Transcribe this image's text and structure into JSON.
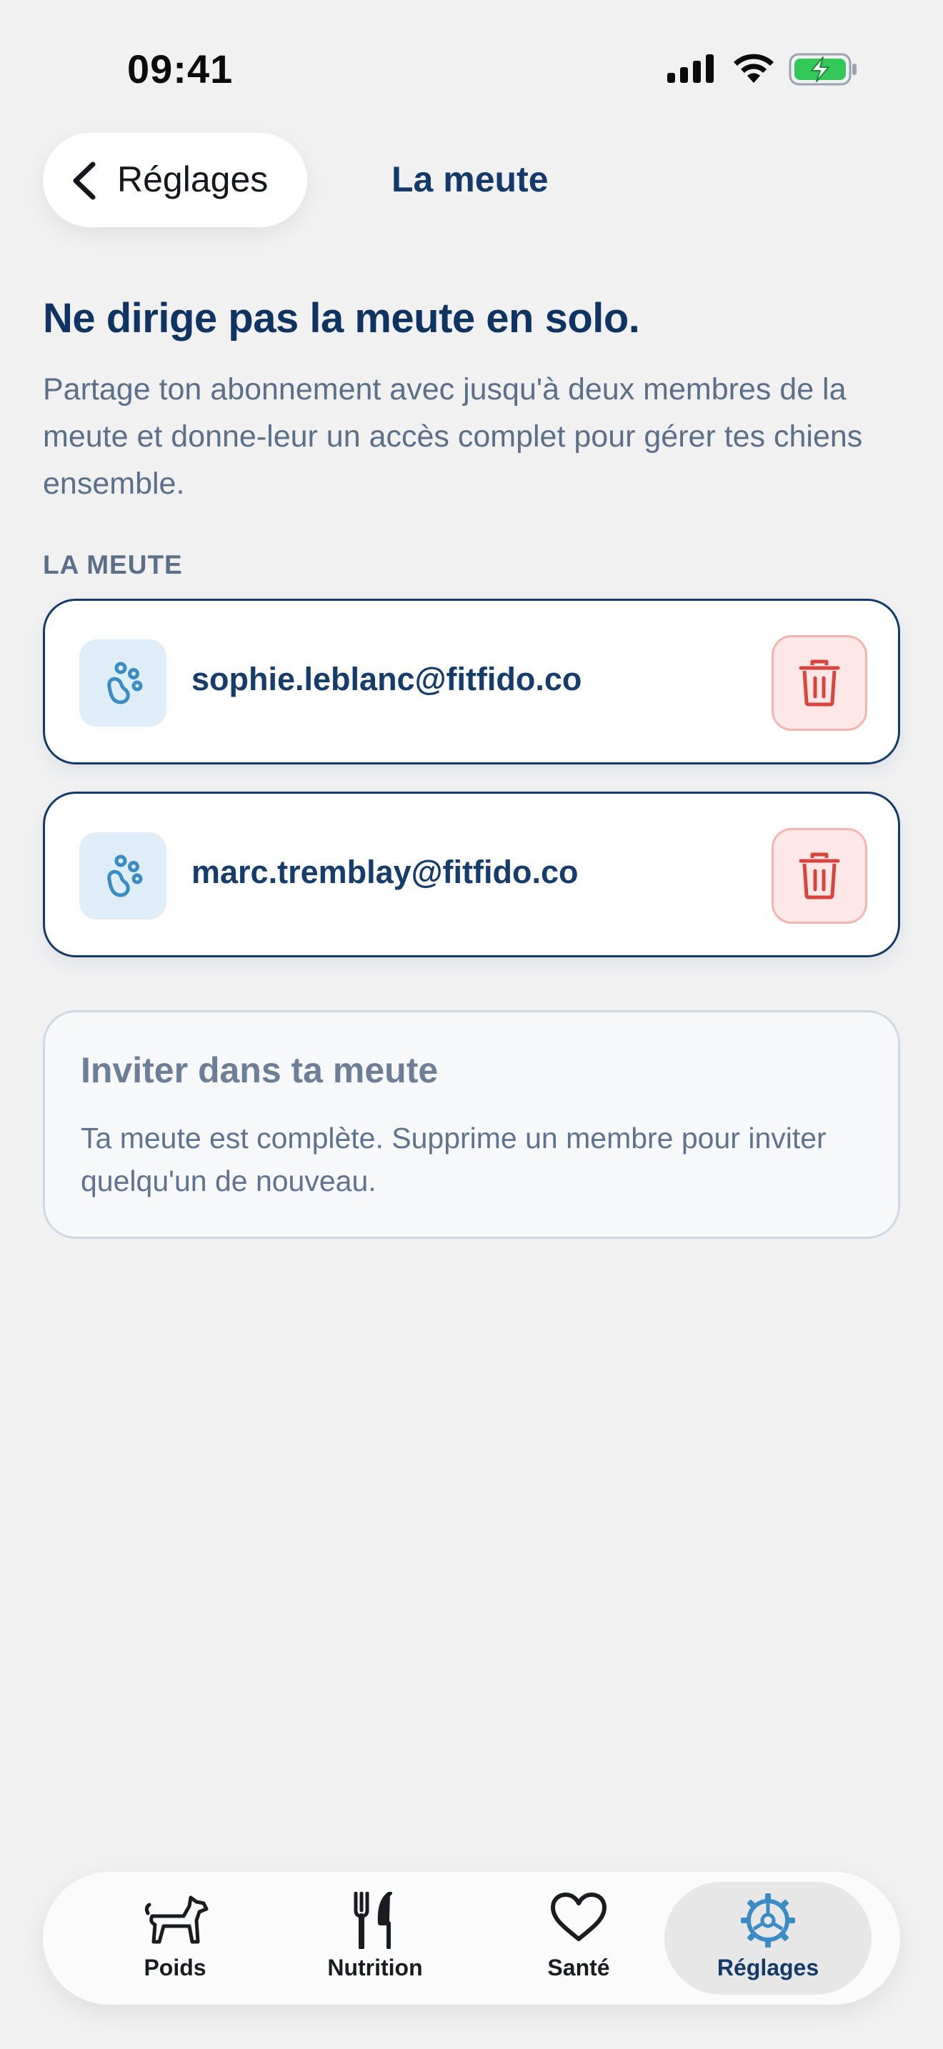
{
  "status_bar": {
    "time": "09:41"
  },
  "header": {
    "back_label": "Réglages",
    "title": "La meute"
  },
  "intro": {
    "headline": "Ne dirige pas la meute en solo.",
    "subtext": "Partage ton abonnement avec jusqu'à deux membres de la meute et donne-leur un accès complet pour gérer tes chiens ensemble."
  },
  "section_label": "LA MEUTE",
  "members": [
    {
      "email": "sophie.leblanc@fitfido.co",
      "icon": "paw-icon",
      "action_icon": "trash-icon"
    },
    {
      "email": "marc.tremblay@fitfido.co",
      "icon": "paw-icon",
      "action_icon": "trash-icon"
    }
  ],
  "invite": {
    "title": "Inviter dans ta meute",
    "description": "Ta meute est complète. Supprime un membre pour inviter quelqu'un de nouveau."
  },
  "tabs": [
    {
      "label": "Poids",
      "icon": "dog-icon",
      "active": false
    },
    {
      "label": "Nutrition",
      "icon": "fork-knife-icon",
      "active": false
    },
    {
      "label": "Santé",
      "icon": "heart-icon",
      "active": false
    },
    {
      "label": "Réglages",
      "icon": "gear-icon",
      "active": true
    }
  ],
  "colors": {
    "accent": "#143a6a",
    "paw_blue": "#3b8cc4",
    "danger": "#d9443d",
    "background": "#f1f1f2"
  }
}
